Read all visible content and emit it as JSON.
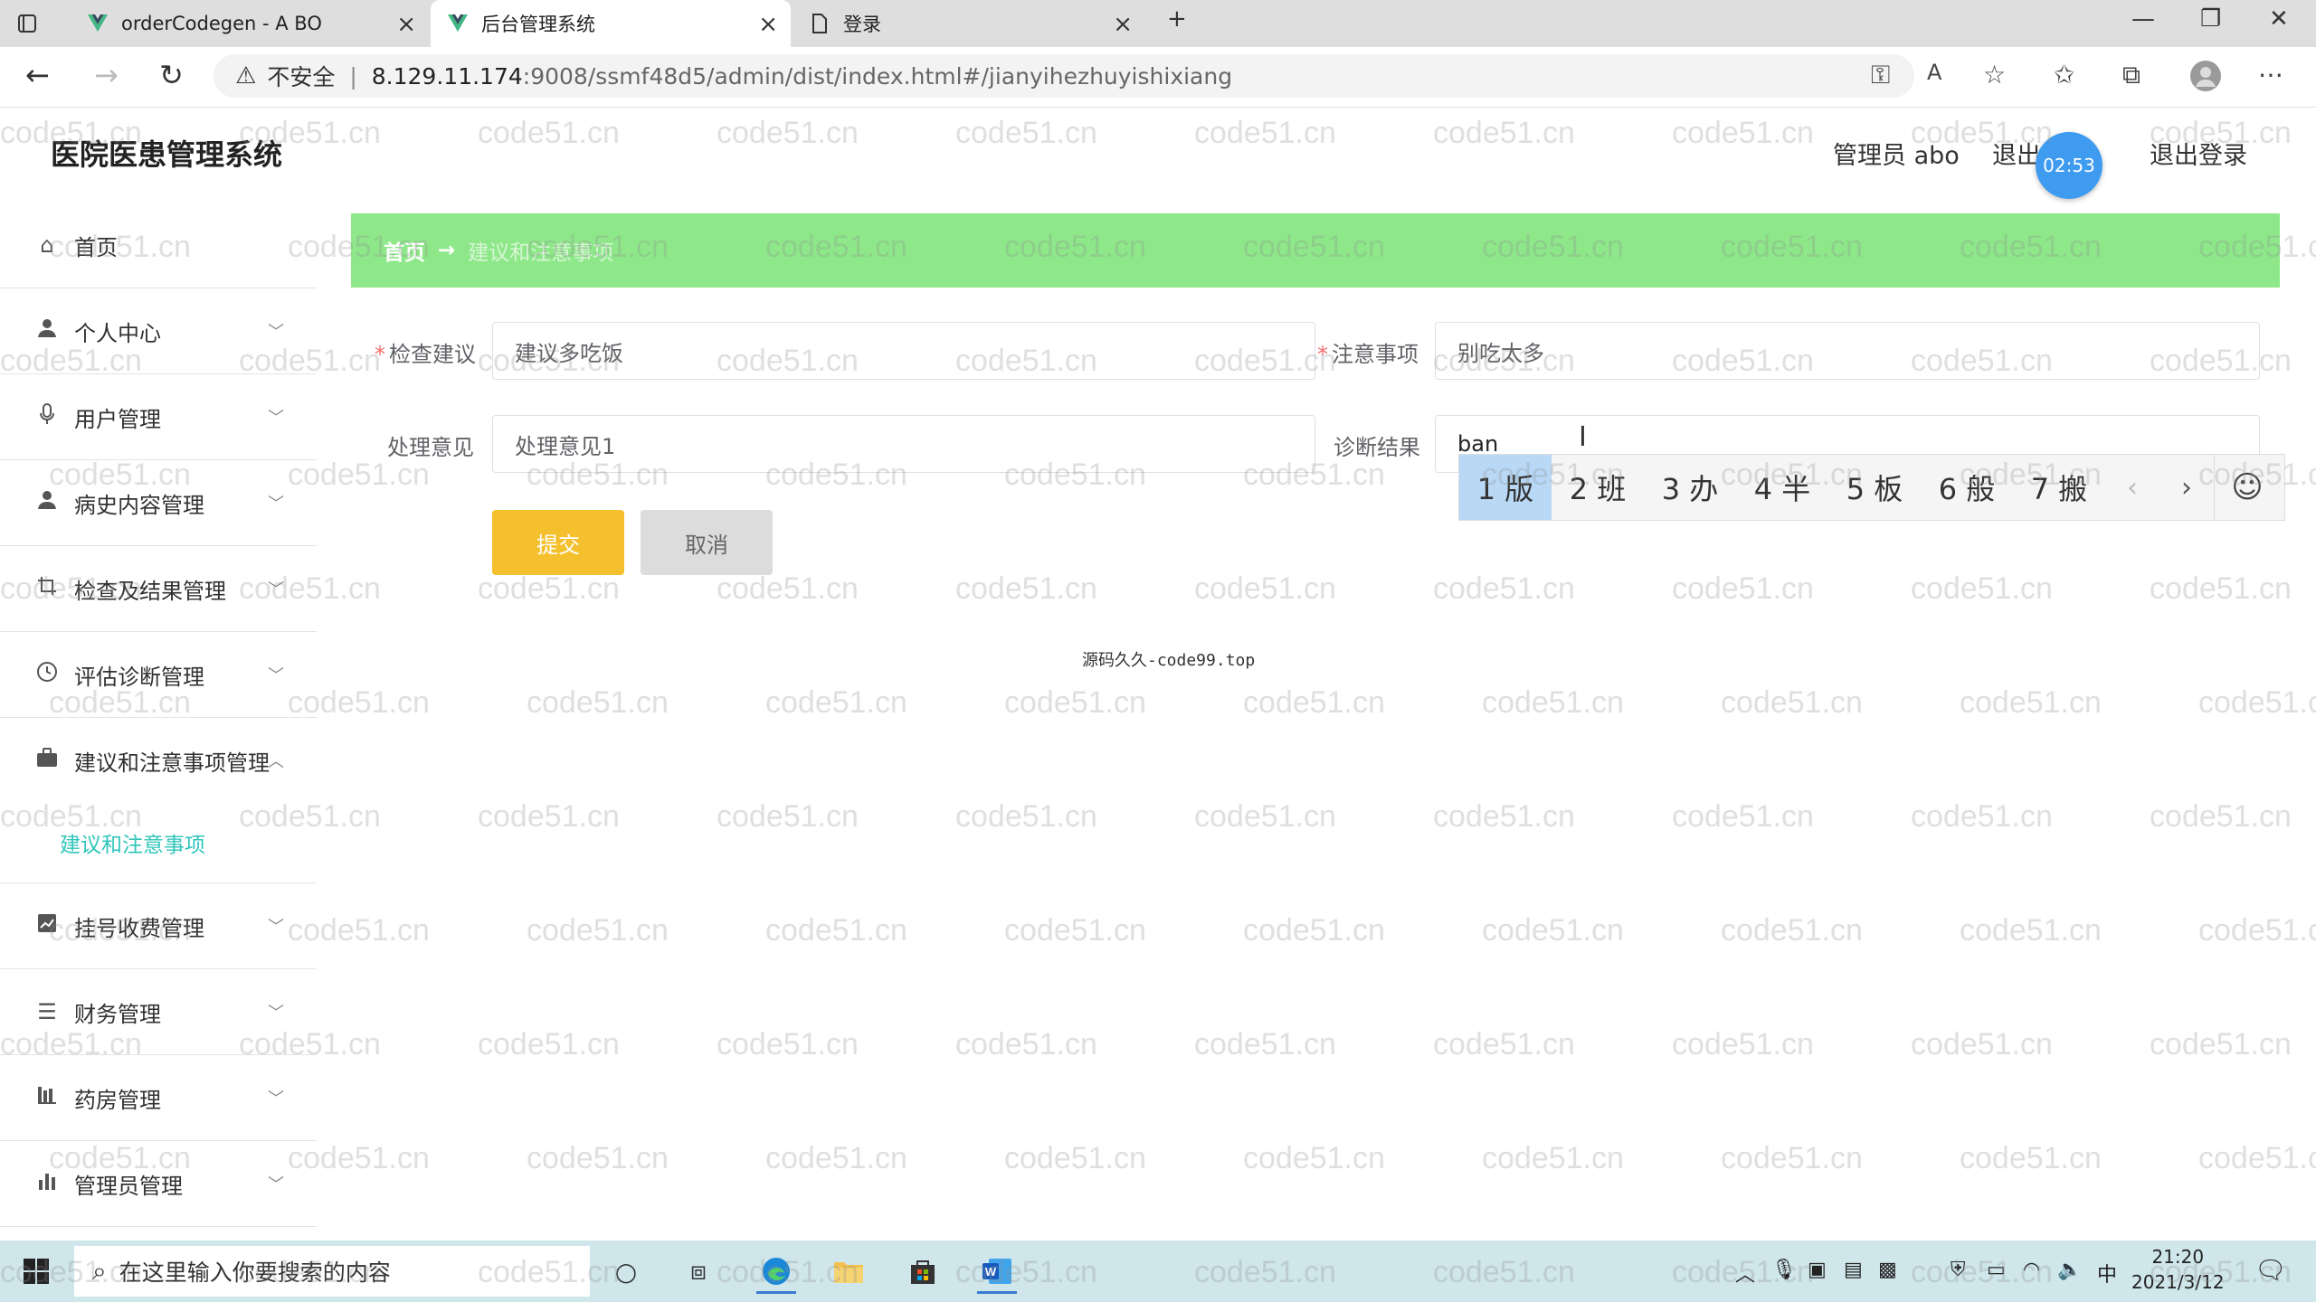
{
  "browser": {
    "tabs": [
      {
        "title": "orderCodegen - A BO"
      },
      {
        "title": "后台管理系统"
      },
      {
        "title": "登录"
      }
    ],
    "url_warning": "不安全",
    "url_host": "8.129.11.174",
    "url_path": ":9008/ssmf48d5/admin/dist/index.html#/jianyihezhuyishixiang"
  },
  "app": {
    "title": "医院医患管理系统",
    "user_label": "管理员 abo",
    "exit_partial": "退出",
    "exit_label": "退出登录",
    "timer": "02:53"
  },
  "sidebar": {
    "items": [
      {
        "label": "首页",
        "icon": "home-icon"
      },
      {
        "label": "个人中心",
        "icon": "user-icon"
      },
      {
        "label": "用户管理",
        "icon": "mic-icon"
      },
      {
        "label": "病史内容管理",
        "icon": "user-icon"
      },
      {
        "label": "检查及结果管理",
        "icon": "crop-icon"
      },
      {
        "label": "评估诊断管理",
        "icon": "clock-icon"
      },
      {
        "label": "建议和注意事项管理",
        "icon": "briefcase-icon"
      },
      {
        "label": "挂号收费管理",
        "icon": "chart-icon"
      },
      {
        "label": "财务管理",
        "icon": "list-icon"
      },
      {
        "label": "药房管理",
        "icon": "bars-icon"
      },
      {
        "label": "管理员管理",
        "icon": "bar-chart-icon"
      }
    ],
    "active_sub": "建议和注意事项"
  },
  "breadcrumb": {
    "home": "首页",
    "separator": "→",
    "current": "建议和注意事项"
  },
  "form": {
    "check_advice_label": "检查建议",
    "check_advice_value": "建议多吃饭",
    "notes_label": "注意事项",
    "notes_value": "别吃太多",
    "handling_label": "处理意见",
    "handling_value": "处理意见1",
    "diagnosis_label": "诊断结果",
    "diagnosis_value": "ban",
    "submit_label": "提交",
    "cancel_label": "取消"
  },
  "ime": {
    "candidates": [
      "1 版",
      "2 班",
      "3 办",
      "4 半",
      "5 板",
      "6 般",
      "7 搬"
    ]
  },
  "footer": "源码久久-code99.top",
  "watermark": "code51.cn",
  "taskbar": {
    "search_placeholder": "在这里输入你要搜索的内容",
    "ime_indicator": "中",
    "time": "21:20",
    "date": "2021/3/12"
  }
}
